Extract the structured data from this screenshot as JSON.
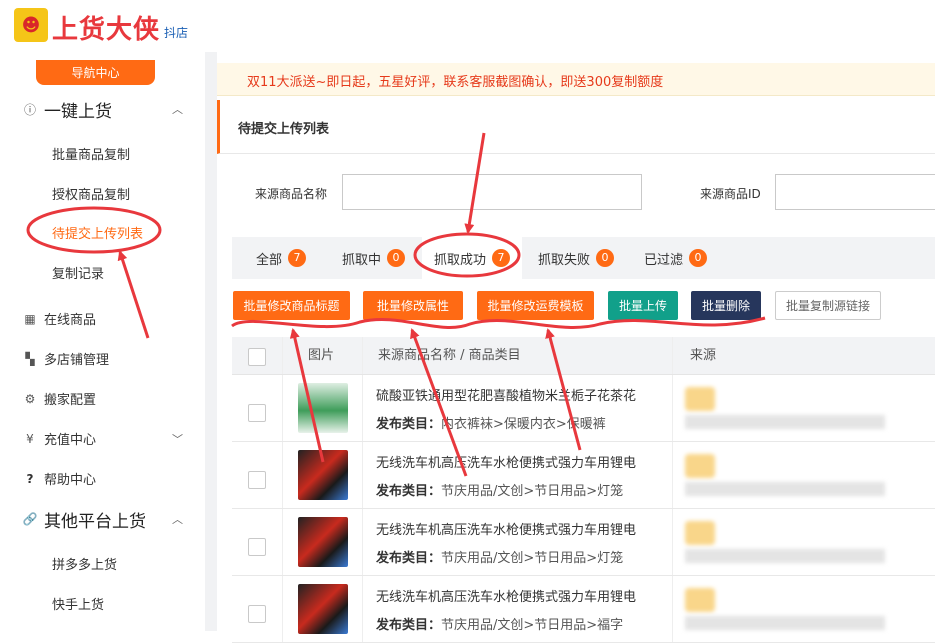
{
  "brand": {
    "name": "上货大侠",
    "sub": "抖店"
  },
  "sidebar": {
    "nav_button": "导航中心",
    "groups": [
      {
        "label": "一键上货",
        "icon": "info-icon",
        "items": [
          "批量商品复制",
          "授权商品复制",
          "待提交上传列表",
          "复制记录"
        ]
      },
      {
        "label": "在线商品",
        "icon": "grid-icon"
      },
      {
        "label": "多店铺管理",
        "icon": "apps-icon"
      },
      {
        "label": "搬家配置",
        "icon": "gear-icon"
      },
      {
        "label": "充值中心",
        "icon": "yen-icon"
      },
      {
        "label": "帮助中心",
        "icon": "question-icon"
      },
      {
        "label": "其他平台上货",
        "icon": "link-icon",
        "items": [
          "拼多多上货",
          "快手上货"
        ]
      }
    ],
    "active_item": "待提交上传列表"
  },
  "notice": "双11大派送~即日起，五星好评，联系客服截图确认，即送300复制额度",
  "page": {
    "title": "待提交上传列表"
  },
  "filters": {
    "source_name_label": "来源商品名称",
    "source_id_label": "来源商品ID",
    "source_name_value": "",
    "source_id_value": ""
  },
  "tabs": [
    {
      "label": "全部",
      "count": "7"
    },
    {
      "label": "抓取中",
      "count": "0"
    },
    {
      "label": "抓取成功",
      "count": "7",
      "selected": true
    },
    {
      "label": "抓取失败",
      "count": "0"
    },
    {
      "label": "已过滤",
      "count": "0"
    }
  ],
  "actions": {
    "edit_titles": "批量修改商品标题",
    "edit_attrs": "批量修改属性",
    "edit_shipping": "批量修改运费模板",
    "upload": "批量上传",
    "delete": "批量删除",
    "copy_links": "批量复制源链接"
  },
  "table": {
    "headers": {
      "image": "图片",
      "name": "来源商品名称 / 商品类目",
      "source": "来源"
    },
    "category_prefix": "发布类目：",
    "rows": [
      {
        "title": "硫酸亚铁通用型花肥喜酸植物米兰栀子花茶花",
        "category": "内衣裤袜>保暖内衣>保暖裤",
        "thumb": "fertilizer"
      },
      {
        "title": "无线洗车机高压洗车水枪便携式强力车用锂电",
        "category": "节庆用品/文创>节日用品>灯笼",
        "thumb": "washer"
      },
      {
        "title": "无线洗车机高压洗车水枪便携式强力车用锂电",
        "category": "节庆用品/文创>节日用品>灯笼",
        "thumb": "washer"
      },
      {
        "title": "无线洗车机高压洗车水枪便携式强力车用锂电",
        "category": "节庆用品/文创>节日用品>福字",
        "thumb": "washer"
      }
    ]
  },
  "colors": {
    "accent": "#ff6a14",
    "annotation": "#e8383d",
    "teal": "#11a08a",
    "navy": "#26365c"
  }
}
